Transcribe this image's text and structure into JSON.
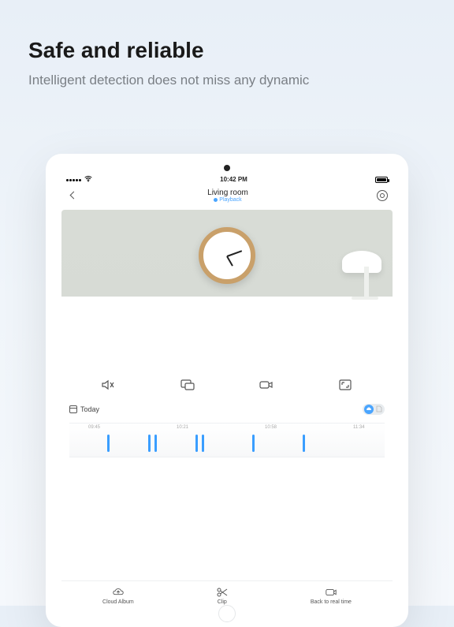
{
  "hero": {
    "title": "Safe and reliable",
    "subtitle": "Intelligent detection does not miss any dynamic"
  },
  "statusbar": {
    "time": "10:42 PM"
  },
  "nav": {
    "title": "Living room",
    "subtitle": "Playback"
  },
  "today": {
    "label": "Today"
  },
  "timeline": {
    "labels": [
      "09:45",
      "10:21",
      "10:58",
      "11:34"
    ],
    "ticks_pct": [
      12,
      25,
      27,
      40,
      42,
      58,
      74
    ]
  },
  "tabs": {
    "cloud": "Cloud Album",
    "clip": "Clip",
    "back": "Back to real time"
  }
}
